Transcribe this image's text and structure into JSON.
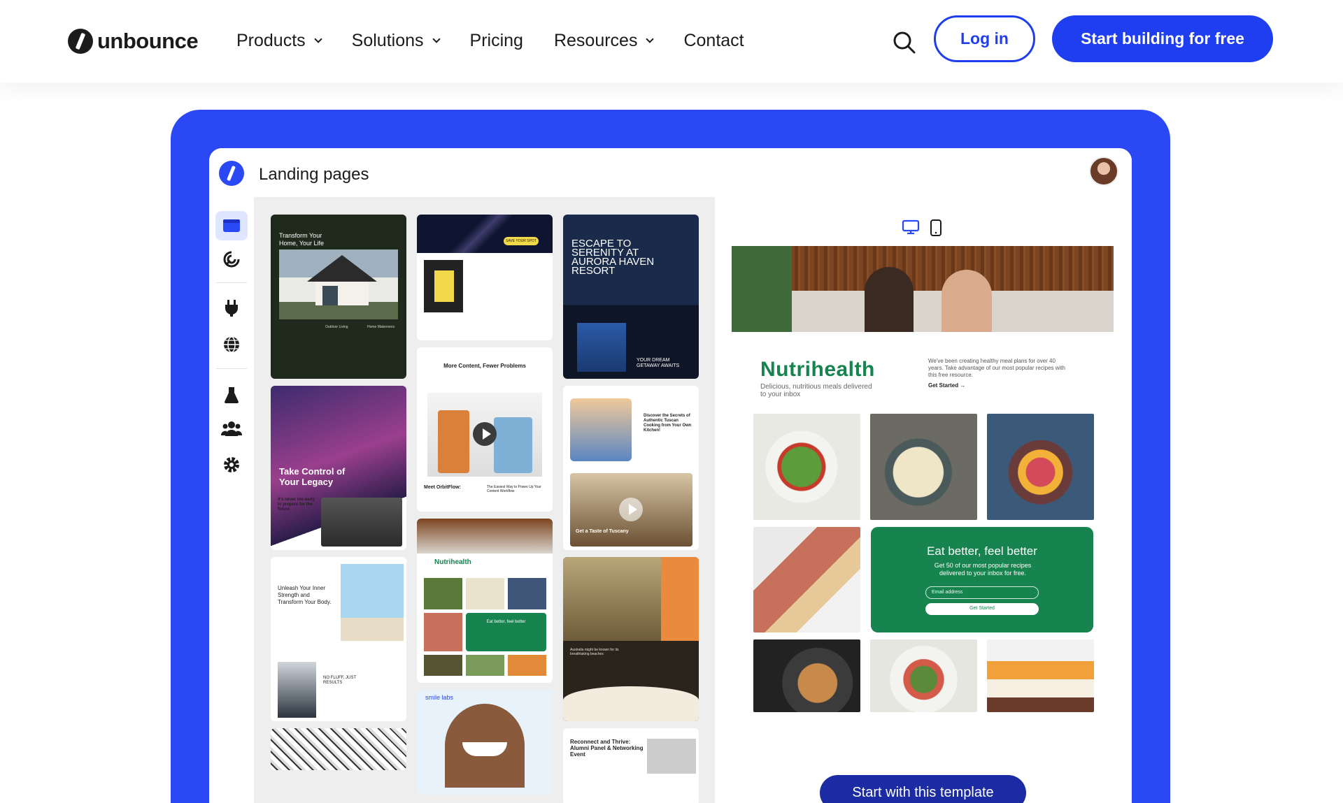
{
  "nav": {
    "logo_text": "unbounce",
    "items": [
      {
        "label": "Products",
        "has_dropdown": true
      },
      {
        "label": "Solutions",
        "has_dropdown": true
      },
      {
        "label": "Pricing",
        "has_dropdown": false
      },
      {
        "label": "Resources",
        "has_dropdown": true
      },
      {
        "label": "Contact",
        "has_dropdown": false
      }
    ],
    "login_label": "Log in",
    "start_label": "Start building for free"
  },
  "app": {
    "title": "Landing pages",
    "sidebar_icons": [
      "pages-icon",
      "ai-swirl-icon",
      "plug-icon",
      "globe-icon",
      "flask-icon",
      "users-icon",
      "gear-icon"
    ]
  },
  "gallery": {
    "cards": [
      {
        "title": "Transform Your Home, Your Life",
        "sub1": "Outdoor Living",
        "sub2": "Home Makeovers"
      },
      {
        "title": "SAVE YOUR SPOT"
      },
      {
        "title": "ESCAPE TO SERENITY AT AURORA HAVEN RESORT",
        "sub1": "YOUR DREAM GETAWAY AWAITS"
      },
      {
        "title": "Take Control of Your Legacy",
        "sub1": "It's never too early to prepare for the future"
      },
      {
        "title": "More Content, Fewer Problems",
        "sub1": "Meet OrbitFlow:",
        "sub2": "The Easiest Way to Power Up Your Content Workflow"
      },
      {
        "title": "Discover the Secrets of Authentic Tuscan Cooking from Your Own Kitchen!",
        "sub1": "Get a Taste of Tuscany"
      },
      {
        "title": "Unleash Your Inner Strength and Transform Your Body.",
        "sub1": "NO FLUFF, JUST RESULTS"
      },
      {
        "title": "Nutrihealth",
        "sub1": "Eat better, feel better"
      },
      {
        "title": "Australia might be known for its breathtaking beaches"
      },
      {
        "title": "smile labs"
      },
      {
        "title": "Reconnect and Thrive: Alumni Panel & Networking Event"
      }
    ]
  },
  "preview": {
    "brand": "Nutrihealth",
    "brand_sub": "Delicious, nutritious meals delivered to your inbox",
    "brand_desc": "We've been creating healthy meal plans for over 40 years. Take advantage of our most popular recipes with this free resource.",
    "brand_cta": "Get Started →",
    "eat_title": "Eat better, feel better",
    "eat_sub": "Get 50 of our most popular recipes delivered to your inbox for free.",
    "eat_input_placeholder": "Email address",
    "eat_button": "Get Started",
    "template_button": "Start with this template"
  },
  "colors": {
    "primary_blue": "#1f3ef0",
    "frame_blue": "#2b48f5",
    "nutri_green": "#17834f",
    "template_button": "#1b2ba3"
  }
}
